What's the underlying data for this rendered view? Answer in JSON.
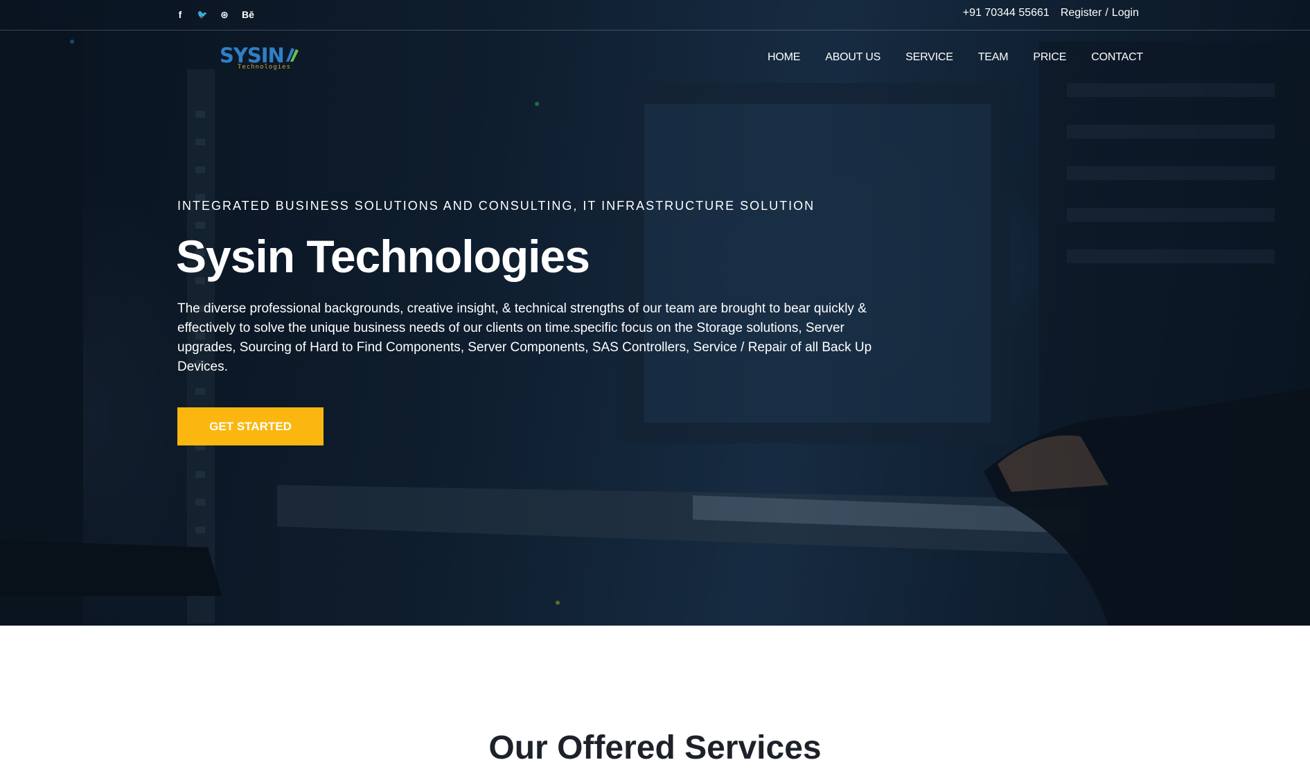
{
  "colors": {
    "accent": "#fbb710",
    "hero_bg": "#13263a",
    "logo_blue": "#2f7fc6",
    "text_light": "#ffffff",
    "heading_dark": "#1d2129"
  },
  "topbar": {
    "socials": [
      {
        "icon": "facebook-icon",
        "glyph": "f"
      },
      {
        "icon": "twitter-icon",
        "glyph": "🐦"
      },
      {
        "icon": "dribbble-icon",
        "glyph": "⊛"
      },
      {
        "icon": "behance-icon",
        "glyph": "Bē"
      }
    ],
    "phone": "+91 70344 55661",
    "register": "Register",
    "separator": "/",
    "login": "Login"
  },
  "logo": {
    "name": "SYSIN",
    "tagline": "Technologies"
  },
  "nav": {
    "items": [
      "HOME",
      "ABOUT US",
      "SERVICE",
      "TEAM",
      "PRICE",
      "CONTACT"
    ]
  },
  "hero": {
    "kicker": "INTEGRATED BUSINESS SOLUTIONS AND CONSULTING, IT INFRASTRUCTURE SOLUTION",
    "title": "Sysin Technologies",
    "description": "The diverse professional backgrounds, creative insight, & technical strengths of our team are brought to bear quickly & effectively to solve the unique business needs of our clients on time.specific focus on the Storage solutions, Server upgrades, Sourcing of Hard to Find Components, Server Components, SAS Controllers, Service / Repair of all Back Up Devices.",
    "cta": "GET STARTED"
  },
  "services": {
    "title": "Our Offered Services"
  }
}
